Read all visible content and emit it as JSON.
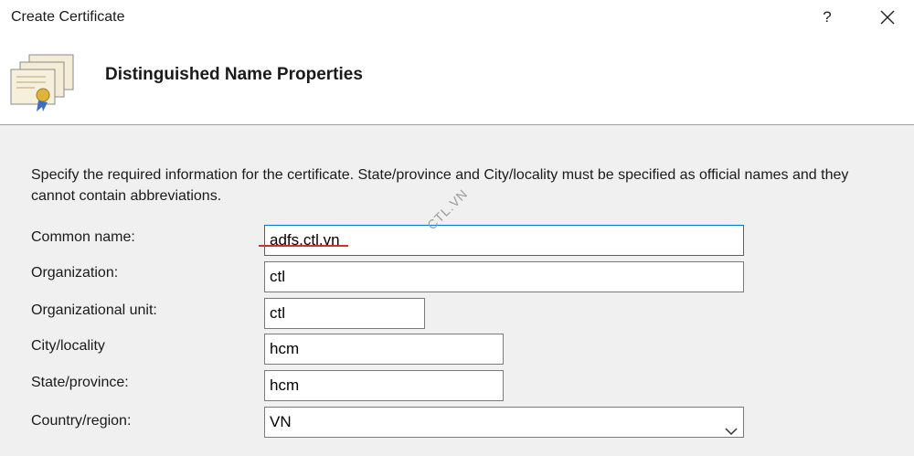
{
  "window": {
    "title": "Create Certificate",
    "help_label": "?"
  },
  "header": {
    "heading": "Distinguished Name Properties",
    "icon": "certificate-icon"
  },
  "description": "Specify the required information for the certificate. State/province and City/locality must be specified as official names and they cannot contain abbreviations.",
  "form": {
    "common_name": {
      "label": "Common name:",
      "value": "adfs.ctl.vn"
    },
    "organization": {
      "label": "Organization:",
      "value": "ctl"
    },
    "organizational_unit": {
      "label": "Organizational unit:",
      "value": "ctl"
    },
    "city": {
      "label": "City/locality",
      "value": "hcm"
    },
    "state": {
      "label": "State/province:",
      "value": "hcm"
    },
    "country": {
      "label": "Country/region:",
      "value": "VN"
    }
  },
  "watermark": "CTL.VN",
  "colors": {
    "focus_border": "#0078d7",
    "annotation_underline": "#d32f2f"
  }
}
